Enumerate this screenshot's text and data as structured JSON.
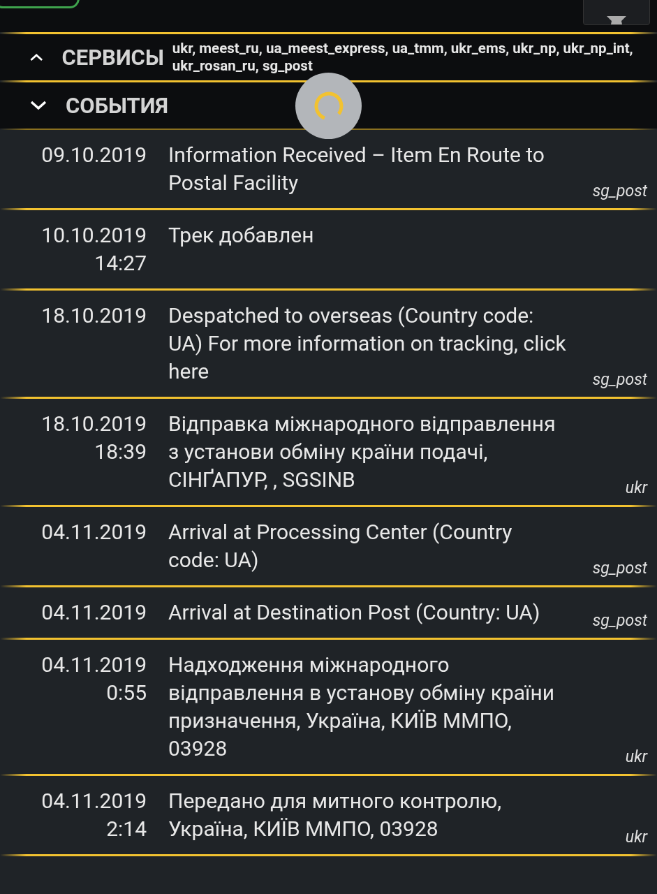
{
  "sections": [
    {
      "title": "СЕРВИСЫ",
      "expanded": true,
      "summary": "ukr, meest_ru, ua_meest_express, ua_tmm, ukr_ems, ukr_np, ukr_np_int, ukr_rosan_ru, sg_post"
    },
    {
      "title": "СОБЫТИЯ",
      "expanded": false
    }
  ],
  "loading": true,
  "events": [
    {
      "date": "09.10.2019",
      "text": "Information Received – Item En Route to Postal Facility",
      "source": "sg_post"
    },
    {
      "date": "10.10.2019",
      "time": "14:27",
      "text": "Трек добавлен"
    },
    {
      "date": "18.10.2019",
      "text": "Despatched to overseas (Country code: UA) For more information on tracking, click here",
      "source": "sg_post"
    },
    {
      "date": "18.10.2019",
      "time": "18:39",
      "text": "Відправка міжнародного відправлення з установи обміну країни подачі, СІНҐАПУР, , SGSINB",
      "source": "ukr"
    },
    {
      "date": "04.11.2019",
      "text": "Arrival at Processing Center (Country code: UA)",
      "source": "sg_post"
    },
    {
      "date": "04.11.2019",
      "text": "Arrival at Destination Post (Country: UA)",
      "source": "sg_post"
    },
    {
      "date": "04.11.2019",
      "time": "0:55",
      "text": "Надходження міжнародного відправлення в установу обміну країни призначення, Україна, КИЇВ ММПО, 03928",
      "source": "ukr"
    },
    {
      "date": "04.11.2019",
      "time": "2:14",
      "text": "Передано для митного контролю, Україна, КИЇВ ММПО, 03928",
      "source": "ukr"
    }
  ]
}
